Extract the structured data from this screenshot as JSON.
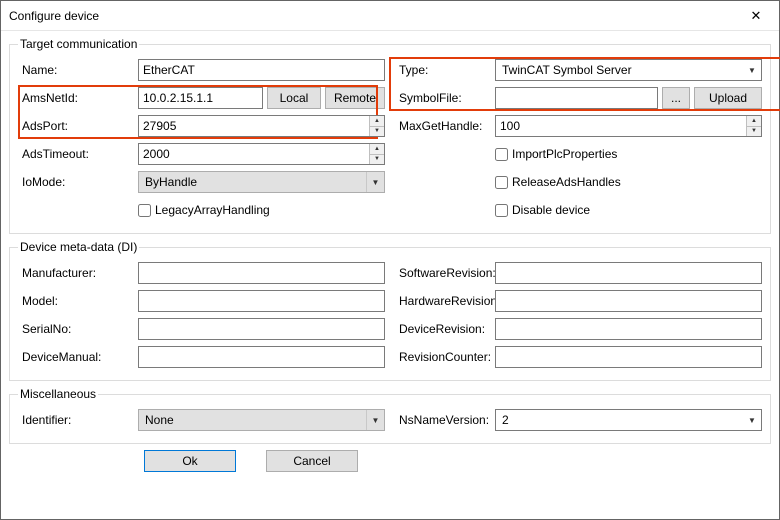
{
  "window": {
    "title": "Configure device",
    "close_glyph": "✕"
  },
  "groups": {
    "target_comm": "Target communication",
    "meta": "Device meta-data (DI)",
    "misc": "Miscellaneous"
  },
  "labels": {
    "name": "Name:",
    "amsnetid": "AmsNetId:",
    "adsport": "AdsPort:",
    "adstimeout": "AdsTimeout:",
    "iomode": "IoMode:",
    "type": "Type:",
    "symbolfile": "SymbolFile:",
    "maxgethandle": "MaxGetHandle:",
    "local_btn": "Local",
    "remote_btn": "Remote",
    "browse_btn": "...",
    "upload_btn": "Upload",
    "legacy_array": "LegacyArrayHandling",
    "import_plc": "ImportPlcProperties",
    "release_ads": "ReleaseAdsHandles",
    "disable_dev": "Disable device",
    "manufacturer": "Manufacturer:",
    "model": "Model:",
    "serialno": "SerialNo:",
    "devicemanual": "DeviceManual:",
    "softrev": "SoftwareRevision:",
    "hardrev": "HardwareRevision:",
    "devicerev": "DeviceRevision:",
    "revcounter": "RevisionCounter:",
    "identifier": "Identifier:",
    "nsnamever": "NsNameVersion:",
    "ok": "Ok",
    "cancel": "Cancel"
  },
  "values": {
    "name": "EtherCAT",
    "amsnetid": "10.0.2.15.1.1",
    "adsport": "27905",
    "adstimeout": "2000",
    "iomode": "ByHandle",
    "type": "TwinCAT Symbol Server",
    "symbolfile": "",
    "maxgethandle": "100",
    "manufacturer": "",
    "model": "",
    "serialno": "",
    "devicemanual": "",
    "softrev": "",
    "hardrev": "",
    "devicerev": "",
    "revcounter": "",
    "identifier": "None",
    "nsnamever": "2"
  }
}
